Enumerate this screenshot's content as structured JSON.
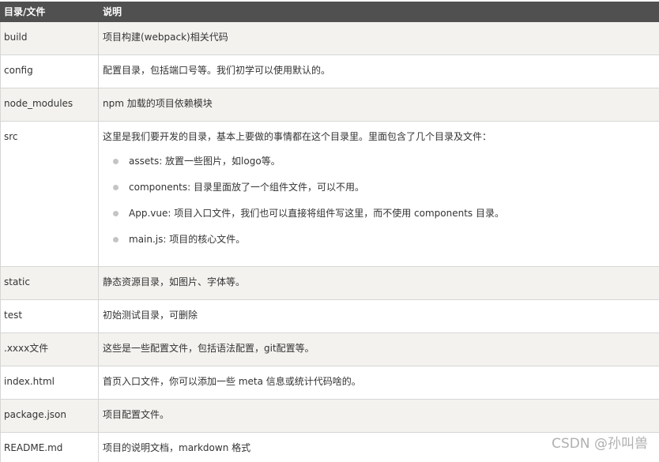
{
  "table": {
    "headers": [
      "目录/文件",
      "说明"
    ],
    "rows": [
      {
        "name": "build",
        "desc": "项目构建(webpack)相关代码"
      },
      {
        "name": "config",
        "desc": "配置目录，包括端口号等。我们初学可以使用默认的。"
      },
      {
        "name": "node_modules",
        "desc": "npm 加载的项目依赖模块"
      },
      {
        "name": "src",
        "desc": "这里是我们要开发的目录，基本上要做的事情都在这个目录里。里面包含了几个目录及文件："
      },
      {
        "name": "static",
        "desc": "静态资源目录，如图片、字体等。"
      },
      {
        "name": "test",
        "desc": "初始测试目录，可删除"
      },
      {
        "name": ".xxxx文件",
        "desc": "这些是一些配置文件，包括语法配置，git配置等。"
      },
      {
        "name": "index.html",
        "desc": "首页入口文件，你可以添加一些 meta 信息或统计代码啥的。"
      },
      {
        "name": "package.json",
        "desc": "项目配置文件。"
      },
      {
        "name": "README.md",
        "desc": "项目的说明文档，markdown 格式"
      }
    ],
    "src_items": [
      "assets: 放置一些图片，如logo等。",
      "components: 目录里面放了一个组件文件，可以不用。",
      "App.vue: 项目入口文件，我们也可以直接将组件写这里，而不使用 components 目录。",
      "main.js: 项目的核心文件。"
    ]
  },
  "watermark": "CSDN @孙叫兽"
}
